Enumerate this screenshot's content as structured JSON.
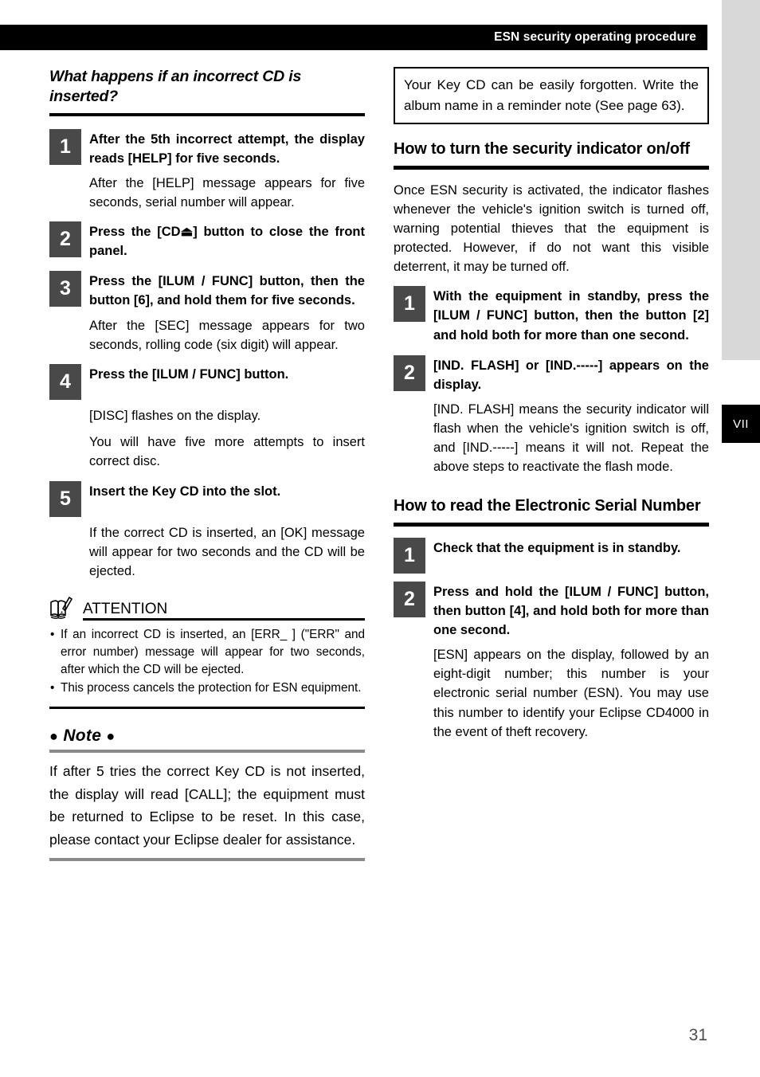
{
  "page": {
    "number": "31",
    "side_tab_label": "VII",
    "header_title": "ESN security operating procedure"
  },
  "left_column": {
    "heading": "What happens if an incorrect CD is inserted?",
    "steps": [
      {
        "num": "1",
        "title": "After the 5th incorrect attempt, the display reads [HELP] for five seconds.",
        "detail": [
          "After the [HELP] message appears for five seconds, serial number will appear."
        ]
      },
      {
        "num": "2",
        "title": "Press the [CD⏏] button to close the front panel.",
        "detail": []
      },
      {
        "num": "3",
        "title": "Press the [ILUM / FUNC] button, then the button [6], and hold them for five seconds.",
        "detail": [
          "After the [SEC] message appears for two seconds, rolling code (six digit) will appear."
        ]
      },
      {
        "num": "4",
        "title": "Press the [ILUM / FUNC] button.",
        "detail": [
          "[DISC] flashes on the display.",
          "You will have five more attempts to insert correct disc."
        ]
      },
      {
        "num": "5",
        "title": "Insert the Key CD into the slot.",
        "detail": [
          "If the correct CD is inserted, an [OK] message will appear for two seconds and the CD will be ejected."
        ]
      }
    ],
    "attention": {
      "icon": "open-book-pen-icon",
      "title": "ATTENTION",
      "bullets": [
        "If an incorrect CD is inserted, an [ERR_ ] (\"ERR\" and error number) message will appear for two seconds, after which the CD will be ejected.",
        "This process cancels the protection for ESN equipment."
      ]
    },
    "note": {
      "title": "Note",
      "bead": "●",
      "text": "If after 5 tries the correct Key CD is not inserted, the display will read [CALL]; the equipment must be returned to Eclipse to be reset. In this case, please contact your Eclipse dealer for assistance."
    }
  },
  "right_column": {
    "tip_box": "Your Key CD can be easily forgotten. Write the album name in a reminder note (See page 63).",
    "section_indicator": {
      "heading": "How to turn the security indicator on/off",
      "intro": "Once ESN security is activated, the indicator flashes whenever the vehicle's ignition switch is turned off, warning potential thieves that the equipment is protected. However, if do not want this visible deterrent, it may be turned off.",
      "steps": [
        {
          "num": "1",
          "title": "With the equipment in standby, press the [ILUM / FUNC] button, then the button [2] and hold both for more than one second.",
          "detail": []
        },
        {
          "num": "2",
          "title": "[IND. FLASH] or [IND.-----] appears on the display.",
          "detail": [
            "[IND. FLASH] means the security indicator will flash when the vehicle's ignition switch is off, and [IND.-----] means it will not. Repeat the above steps to reactivate the flash mode."
          ]
        }
      ]
    },
    "section_esn": {
      "heading": "How to read the Electronic Serial Number",
      "steps": [
        {
          "num": "1",
          "title": "Check that the equipment is in standby.",
          "detail": []
        },
        {
          "num": "2",
          "title": "Press and hold the [ILUM / FUNC] button, then button [4], and hold both for more than one second.",
          "detail": [
            "[ESN] appears on the display, followed by an eight-digit number; this number is your electronic serial number (ESN). You may use this number to identify your Eclipse CD4000 in the event of theft recovery."
          ]
        }
      ]
    }
  },
  "colors": {
    "header_bar": "#000000",
    "step_number_box": "#494949",
    "side_gray": "#d8d8d8",
    "side_tab": "#000000",
    "rule_gray": "#8a8a8a",
    "page_number": "#4d4d4d"
  }
}
